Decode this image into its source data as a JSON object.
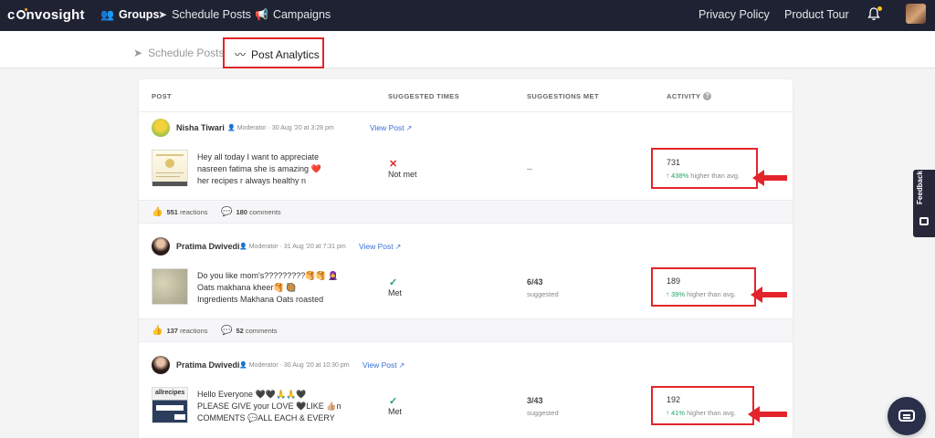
{
  "brand": {
    "logo_text_1": "c",
    "logo_text_2": "nvosight"
  },
  "topnav": {
    "items": [
      {
        "label": "Groups",
        "icon": "groups-icon"
      },
      {
        "label": "Schedule Posts",
        "icon": "send-icon"
      },
      {
        "label": "Campaigns",
        "icon": "megaphone-icon"
      }
    ],
    "right": [
      {
        "label": "Privacy Policy"
      },
      {
        "label": "Product Tour"
      }
    ]
  },
  "subnav": {
    "tabs": [
      {
        "label": "Schedule Posts",
        "icon": "send-icon"
      },
      {
        "label": "Post Analytics",
        "icon": "analytics-icon"
      }
    ],
    "active": "Post Analytics"
  },
  "table": {
    "headers": [
      "POST",
      "SUGGESTED TIMES",
      "SUGGESTIONS MET",
      "ACTIVITY"
    ]
  },
  "posts": [
    {
      "author": "Nisha Tiwari",
      "meta": "Moderator · 30 Aug '20 at 3:28 pm",
      "view_post": "View Post",
      "text_lines": [
        "Hey all today I want to appreciate",
        "nasreen fatima she is amazing ❤️",
        "her recipes r always healthy n"
      ],
      "status_icon": "✕",
      "status": "Not met",
      "suggestions_met": "--",
      "suggestions_sub": "",
      "activity": "731",
      "activity_pct": "438%",
      "activity_note": "higher than avg.",
      "reactions": "551",
      "reactions_label": "reactions",
      "comments": "180",
      "comments_label": "comments"
    },
    {
      "author": "Pratima Dwivedi",
      "meta": "Moderator · 31 Aug '20 at 7:31 pm",
      "view_post": "View Post",
      "text_lines": [
        "Do you like mom's?????????🥞🥞 🧕",
        "Oats makhana kheer🥞 🥘",
        "Ingredients Makhana Oats roasted"
      ],
      "status_icon": "✓",
      "status": "Met",
      "suggestions_met": "6/43",
      "suggestions_sub": "suggested",
      "activity": "189",
      "activity_pct": "39%",
      "activity_note": "higher than avg.",
      "reactions": "137",
      "reactions_label": "reactions",
      "comments": "52",
      "comments_label": "comments"
    },
    {
      "author": "Pratima Dwivedi",
      "meta": "Moderator · 30 Aug '20 at 10:30 pm",
      "view_post": "View Post",
      "text_lines": [
        "Hello Everyone 🖤🖤🙏🙏🖤",
        "PLEASE GIVE your LOVE 🖤LIKE 👍🏼n",
        "COMMENTS 💬ALL EACH & EVERY"
      ],
      "status_icon": "✓",
      "status": "Met",
      "suggestions_met": "3/43",
      "suggestions_sub": "suggested",
      "activity": "192",
      "activity_pct": "41%",
      "activity_note": "higher than avg."
    }
  ],
  "feedback": {
    "label": "Feedback"
  },
  "colors": {
    "nav_bg": "#1f2233",
    "link": "#3a6fd8",
    "positive": "#1da564",
    "highlight": "#e3242b"
  }
}
